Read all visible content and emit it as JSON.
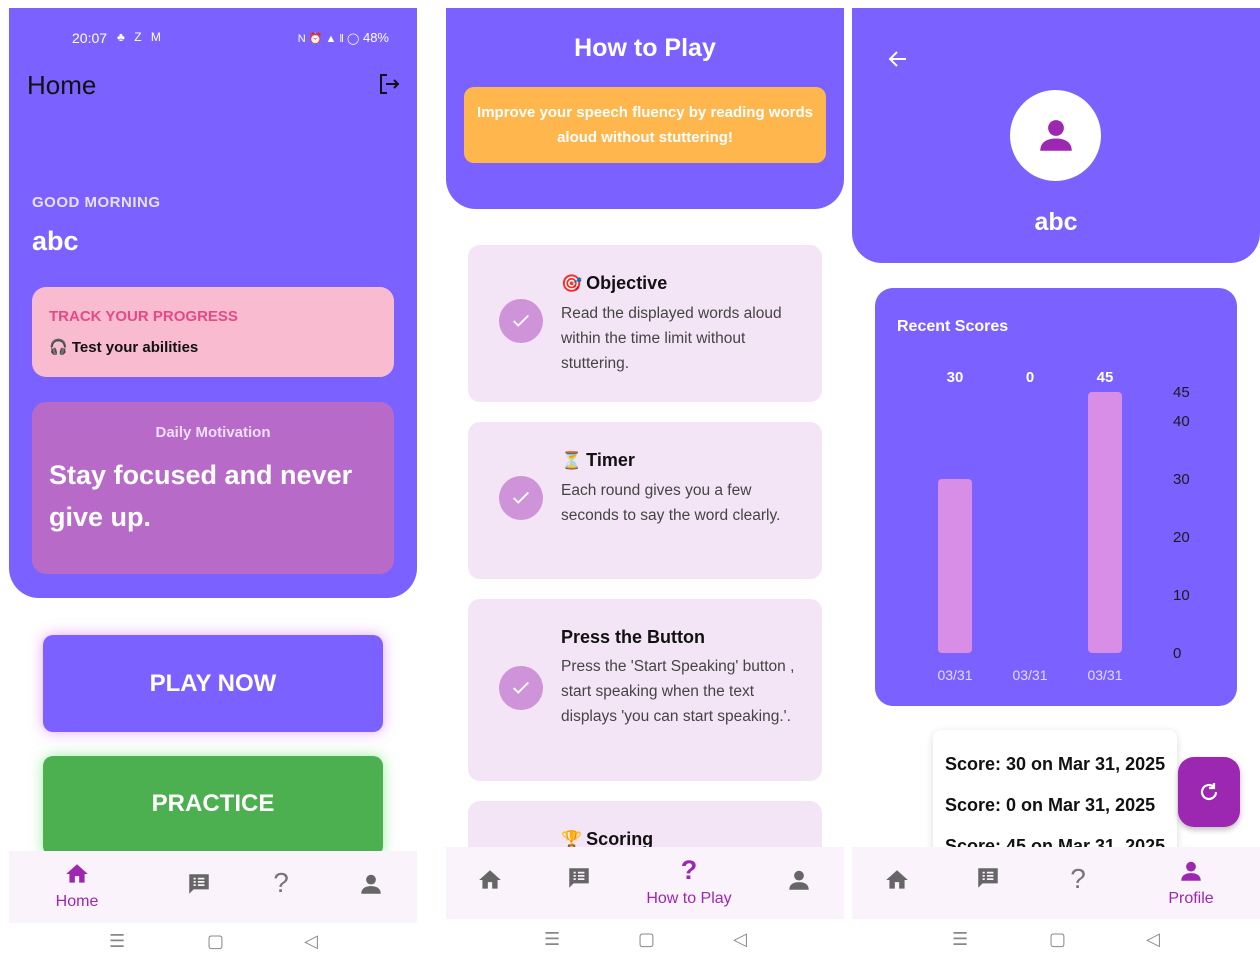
{
  "screen1": {
    "status": {
      "time": "20:07",
      "left_icons": "♣ Z M",
      "right_icons": "N ⏰ ▲ ‖ ◯",
      "battery": "48%"
    },
    "title": "Home",
    "greeting": "GOOD MORNING",
    "user_name": "abc",
    "progress_card": {
      "title": "TRACK YOUR PROGRESS",
      "subtitle": "🎧 Test your abilities"
    },
    "motivation_card": {
      "label": "Daily Motivation",
      "quote": "Stay focused and never give up."
    },
    "play_button": "PLAY NOW",
    "practice_button": "PRACTICE",
    "nav": {
      "home_label": "Home",
      "active": "home"
    }
  },
  "screen2": {
    "title": "How to Play",
    "banner": "Improve your speech fluency by reading words aloud without stuttering!",
    "rules": [
      {
        "emoji": "🎯",
        "title": "Objective",
        "desc": "Read the displayed words aloud within the time limit without stuttering."
      },
      {
        "emoji": "⏳",
        "title": "Timer",
        "desc": "Each round gives you a few seconds to say the word clearly."
      },
      {
        "emoji": "",
        "title": "Press the Button",
        "desc": "Press the 'Start Speaking' button , start speaking when the text displays 'you can start speaking.'."
      },
      {
        "emoji": "🏆",
        "title": "Scoring",
        "desc": ""
      }
    ],
    "nav": {
      "howto_label": "How to Play",
      "active": "howto"
    }
  },
  "screen3": {
    "user_name": "abc",
    "chart_data": {
      "type": "bar",
      "title": "Recent Scores",
      "categories": [
        "03/31",
        "03/31",
        "03/31"
      ],
      "values": [
        30,
        0,
        45
      ],
      "y_ticks": [
        0,
        10,
        20,
        30,
        40,
        45
      ],
      "ylim": [
        0,
        45
      ],
      "bar_color": "#d88ee6",
      "y_axis_side": "right",
      "show_value_labels": true
    },
    "score_list": [
      "Score: 30 on Mar 31, 2025",
      "Score: 0 on Mar 31, 2025",
      "Score: 45 on Mar 31, 2025"
    ],
    "nav": {
      "profile_label": "Profile",
      "active": "profile"
    }
  },
  "colors": {
    "primary": "#7b61ff",
    "accent": "#9c27b0",
    "green": "#4caf50",
    "orange": "#ffb74d",
    "pink": "#f8bbd0",
    "motivation": "#b76ac8"
  }
}
